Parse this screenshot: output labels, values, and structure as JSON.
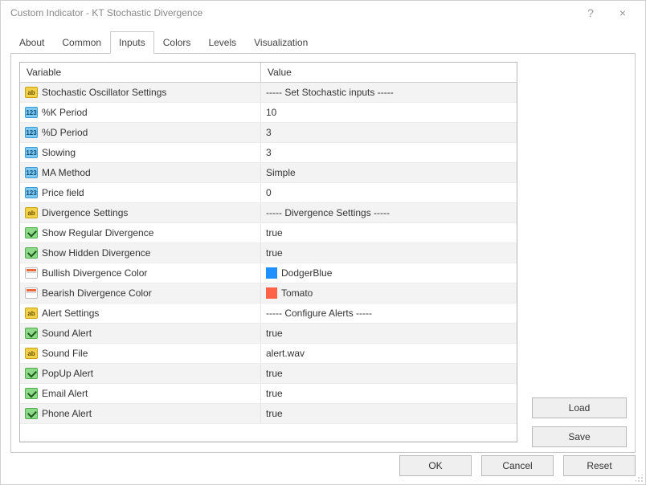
{
  "window": {
    "title": "Custom Indicator - KT Stochastic Divergence",
    "help": "?",
    "close": "×"
  },
  "tabs": [
    "About",
    "Common",
    "Inputs",
    "Colors",
    "Levels",
    "Visualization"
  ],
  "activeTab": "Inputs",
  "columns": {
    "variable": "Variable",
    "value": "Value"
  },
  "rows": [
    {
      "icon": "str",
      "name": "Stochastic Oscillator Settings",
      "value": "----- Set Stochastic inputs -----"
    },
    {
      "icon": "num",
      "name": "%K Period",
      "value": "10"
    },
    {
      "icon": "num",
      "name": "%D Period",
      "value": "3"
    },
    {
      "icon": "num",
      "name": "Slowing",
      "value": "3"
    },
    {
      "icon": "num",
      "name": "MA Method",
      "value": "Simple"
    },
    {
      "icon": "num",
      "name": "Price field",
      "value": "0"
    },
    {
      "icon": "str",
      "name": "Divergence Settings",
      "value": "----- Divergence Settings -----"
    },
    {
      "icon": "boo",
      "name": "Show Regular Divergence",
      "value": "true"
    },
    {
      "icon": "boo",
      "name": "Show Hidden Divergence",
      "value": "true"
    },
    {
      "icon": "clr",
      "name": "Bullish Divergence Color",
      "value": "DodgerBlue",
      "swatch": "#1e90ff"
    },
    {
      "icon": "clr",
      "name": "Bearish Divergence Color",
      "value": "Tomato",
      "swatch": "#ff6347"
    },
    {
      "icon": "str",
      "name": "Alert Settings",
      "value": "----- Configure Alerts -----"
    },
    {
      "icon": "boo",
      "name": "Sound Alert",
      "value": "true"
    },
    {
      "icon": "str",
      "name": "Sound File",
      "value": "alert.wav"
    },
    {
      "icon": "boo",
      "name": "PopUp Alert",
      "value": "true"
    },
    {
      "icon": "boo",
      "name": "Email Alert",
      "value": "true"
    },
    {
      "icon": "boo",
      "name": "Phone Alert",
      "value": "true"
    }
  ],
  "buttons": {
    "load": "Load",
    "save": "Save",
    "ok": "OK",
    "cancel": "Cancel",
    "reset": "Reset"
  }
}
